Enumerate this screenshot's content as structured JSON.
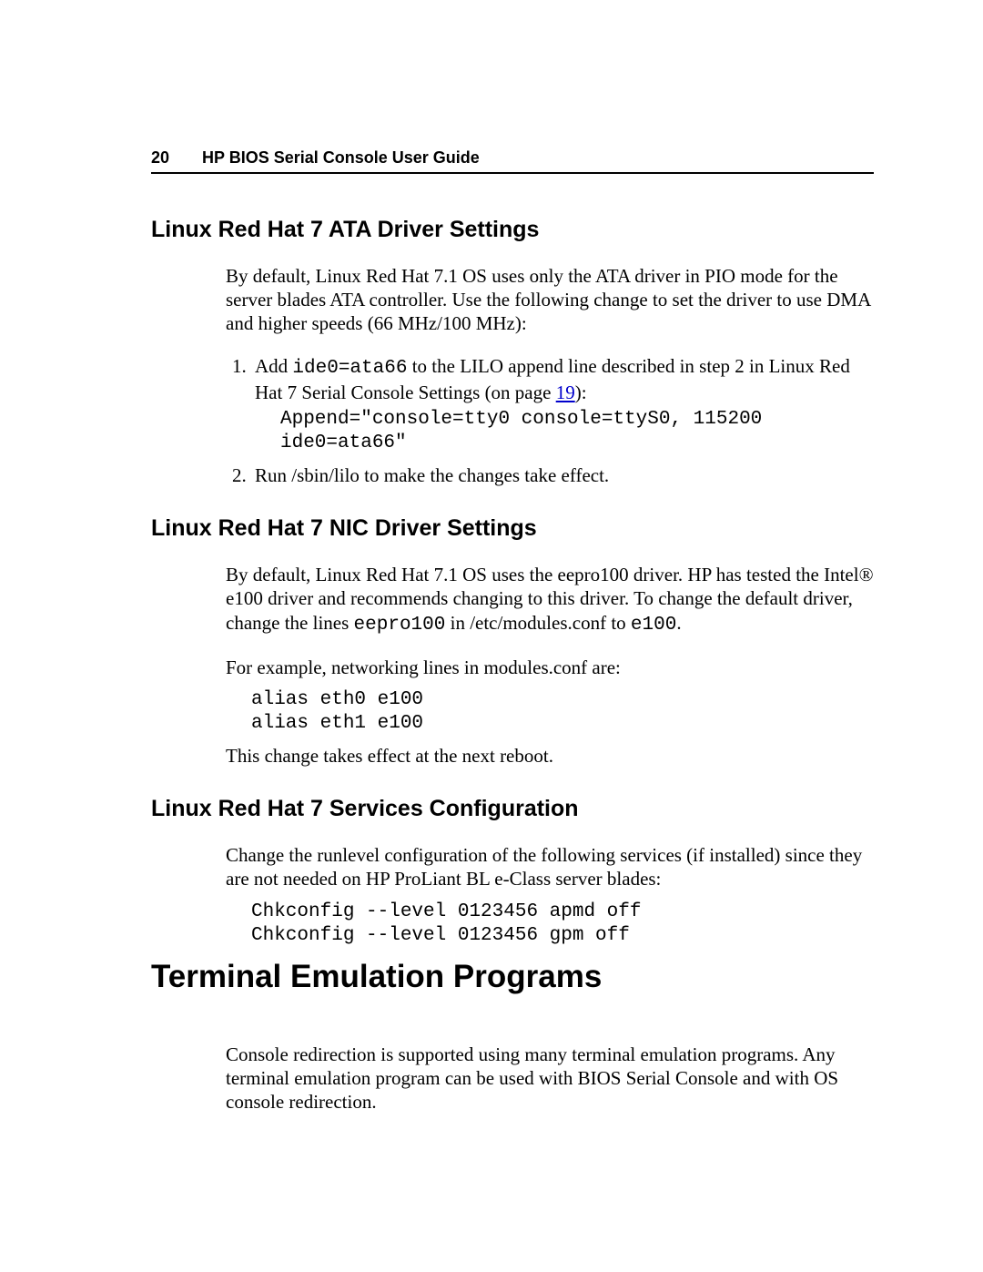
{
  "header": {
    "page_number": "20",
    "doc_title": "HP BIOS Serial Console User Guide"
  },
  "sections": {
    "ata": {
      "heading": "Linux Red Hat 7 ATA Driver Settings",
      "intro": "By default, Linux Red Hat 7.1 OS uses only the ATA driver in PIO mode for the server blades ATA controller. Use the following change to set the driver to use DMA and higher speeds (66 MHz/100 MHz):",
      "step1_pre": "Add ",
      "step1_code_inline": "ide0=ata66",
      "step1_post_a": " to the LILO append line described in step 2 in Linux Red Hat 7 Serial Console Settings (on page ",
      "step1_link": "19",
      "step1_post_b": "):",
      "step1_block": "Append=\"console=tty0 console=ttyS0, 115200\nide0=ata66\"",
      "step2": "Run /sbin/lilo to make the changes take effect."
    },
    "nic": {
      "heading": "Linux Red Hat 7 NIC Driver Settings",
      "p1_a": "By default, Linux Red Hat 7.1 OS uses the eepro100 driver. HP has tested the Intel® e100 driver and recommends changing to this driver. To change the default driver, change the lines ",
      "p1_code1": "eepro100",
      "p1_b": " in /etc/modules.conf to ",
      "p1_code2": "e100",
      "p1_c": ".",
      "p2": "For example, networking lines in modules.conf are:",
      "block": "alias eth0 e100\nalias eth1 e100",
      "p3": "This change takes effect at the next reboot."
    },
    "svc": {
      "heading": "Linux Red Hat 7 Services Configuration",
      "p1": "Change the runlevel configuration of the following services (if installed) since they are not needed on HP ProLiant BL e-Class server blades:",
      "block": "Chkconfig --level 0123456 apmd off\nChkconfig --level 0123456 gpm off"
    },
    "term": {
      "heading": "Terminal Emulation Programs",
      "p1": "Console redirection is supported using many terminal emulation programs. Any terminal emulation program can be used with BIOS Serial Console and with OS console redirection."
    }
  }
}
